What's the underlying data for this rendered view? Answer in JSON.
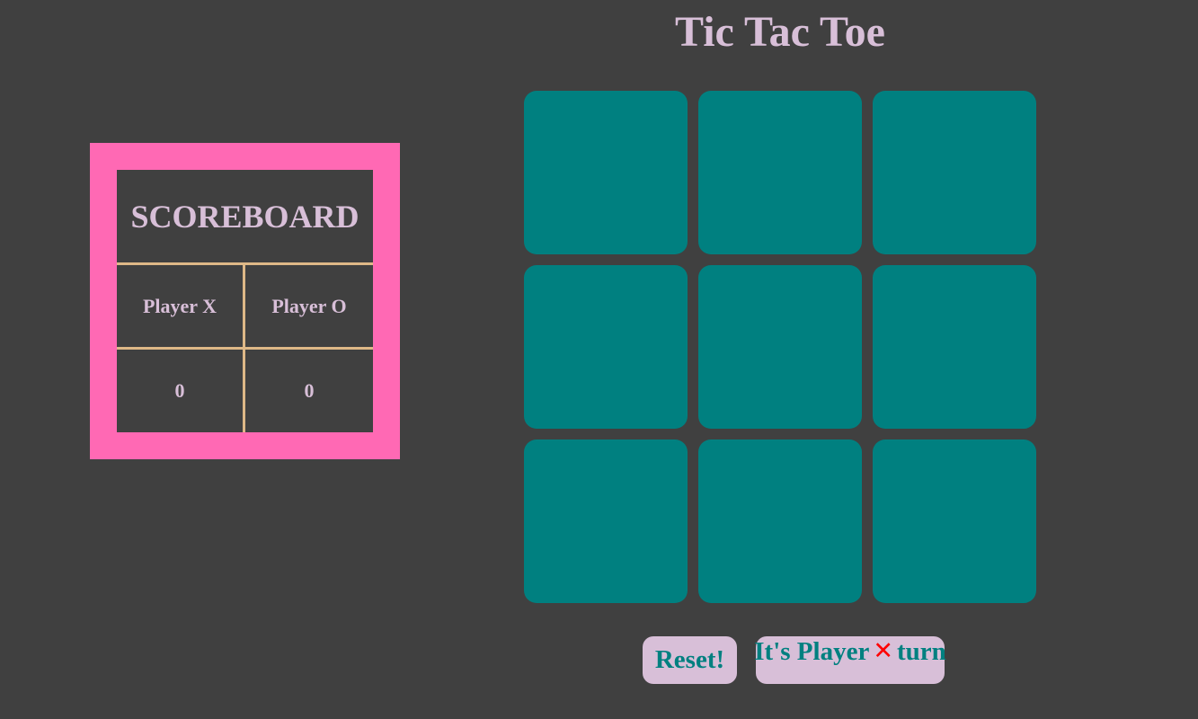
{
  "title": "Tic Tac Toe",
  "scoreboard": {
    "heading": "SCOREBOARD",
    "player_x_label": "Player X",
    "player_o_label": "Player O",
    "player_x_score": "0",
    "player_o_score": "0"
  },
  "board": {
    "cells": [
      "",
      "",
      "",
      "",
      "",
      "",
      "",
      "",
      ""
    ]
  },
  "controls": {
    "reset_label": "Reset!",
    "status_prefix": "It's Player",
    "status_mark": "✕",
    "status_suffix": "turn"
  },
  "colors": {
    "background": "#404040",
    "scoreboard_frame": "#ff69b4",
    "scoreboard_divider": "#deb887",
    "cell": "#008080",
    "text": "#d8bfd8",
    "button_bg": "#d8bfd8",
    "button_text": "#008080",
    "turn_mark": "#ff0000"
  }
}
